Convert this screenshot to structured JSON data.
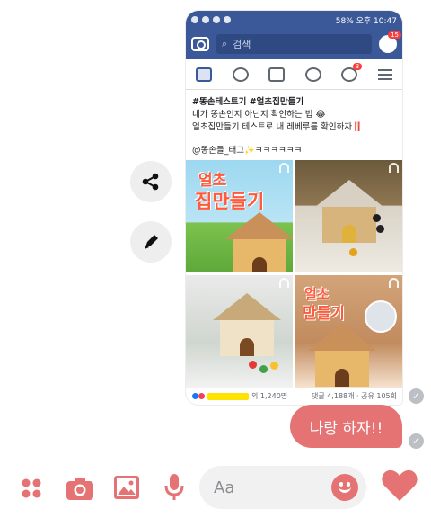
{
  "status_bar": {
    "signal": "58%",
    "time": "오후 10:47"
  },
  "fb_header": {
    "search_placeholder": "검색",
    "messenger_badge": "15",
    "notification_badge": "3"
  },
  "post": {
    "tags": "#똥손테스트기 #얼초집만들기",
    "line1": "내가 똥손인지 아닌지 확인하는 법 😂",
    "line2": "얼초집만들기 테스트로 내 레베루를 확인하자‼️",
    "mention": "@똥손들_태그✨ㅋㅋㅋㅋㅋㅋ",
    "image_texts": {
      "box_title_1": "얼초",
      "box_title_2": "집만들기",
      "box_title_3": "얼초",
      "box_title_4": "만들기"
    },
    "reactions_suffix": "외 1,240명",
    "comments_shares": "댓글 4,188개 · 공유 105회"
  },
  "message": {
    "text": "나랑 하자!!"
  },
  "composer": {
    "placeholder": "Aa"
  },
  "colors": {
    "accent": "#e57373",
    "facebook_blue": "#3b5998"
  }
}
